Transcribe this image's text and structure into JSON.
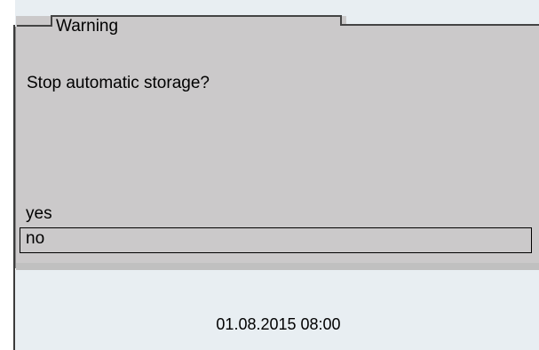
{
  "dialog": {
    "title": "Warning",
    "message": "Stop automatic storage?",
    "options": [
      {
        "label": "yes",
        "selected": false
      },
      {
        "label": "no",
        "selected": true
      }
    ]
  },
  "status_bar": {
    "datetime": "01.08.2015 08:00"
  },
  "colors": {
    "panel": "#cbc9ca",
    "background": "#e8eef2",
    "frame": "#3a3a3a"
  }
}
